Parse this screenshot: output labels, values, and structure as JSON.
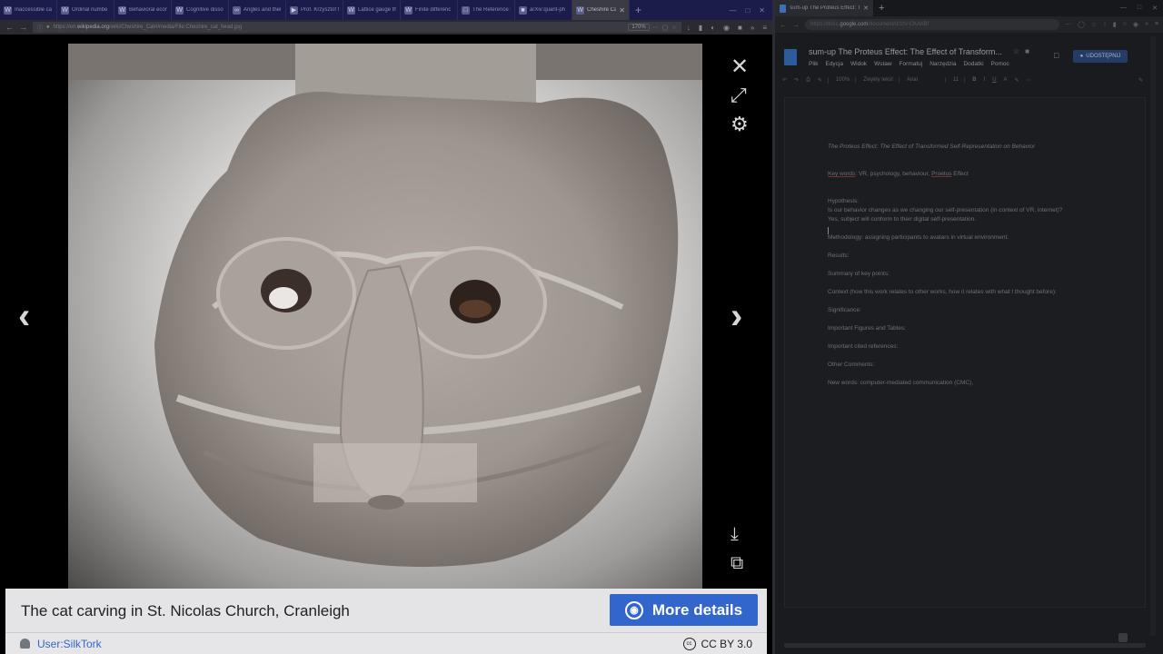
{
  "left_browser": {
    "tabs": [
      {
        "title": "Inaccessible ca",
        "favicon": "W"
      },
      {
        "title": "Ordinal numbe",
        "favicon": "W"
      },
      {
        "title": "Behavioral econ",
        "favicon": "W"
      },
      {
        "title": "Cognitive disso",
        "favicon": "W"
      },
      {
        "title": "Angles and thei",
        "favicon": "∞"
      },
      {
        "title": "Prof. Krzysztof M",
        "favicon": "▶"
      },
      {
        "title": "Lattice gauge th",
        "favicon": "W"
      },
      {
        "title": "Finite differenc",
        "favicon": "W"
      },
      {
        "title": "The Reference F",
        "favicon": "□"
      },
      {
        "title": "arXiv:quant-ph",
        "favicon": "■"
      },
      {
        "title": "Cheshire Ca",
        "favicon": "W",
        "active": true
      }
    ],
    "new_tab": "+",
    "url_prefix": "https://en.",
    "url_domain": "wikipedia.org",
    "url_path": "/wiki/Cheshire_Cat#/media/File:Cheshire_cat_head.jpg",
    "zoom": "170%"
  },
  "media_viewer": {
    "close_icon": "close-icon",
    "fullscreen_icon": "fullscreen-icon",
    "settings_icon": "gear-icon",
    "prev_icon": "chevron-left-icon",
    "next_icon": "chevron-right-icon",
    "download_icon": "download-icon",
    "share_icon": "share-icon",
    "caption": "The cat carving in St. Nicolas Church, Cranleigh",
    "more_details": "More details",
    "author": "User:SilkTork",
    "license": "CC BY 3.0",
    "license_badge": "cc"
  },
  "right_browser": {
    "tab_title": "sum-up The Proteus Effect: The",
    "url_prefix": "https://docs.",
    "url_domain": "google.com",
    "url_path": "/document/d/1tV-CKAhBf",
    "doc": {
      "title": "sum-up The Proteus Effect: The Effect of Transform...",
      "menu": [
        "Plik",
        "Edycja",
        "Widok",
        "Wstaw",
        "Formatuj",
        "Narzędzia",
        "Dodatki",
        "Pomoc"
      ],
      "share": "UDOSTĘPNIJ",
      "toolbar": {
        "zoom": "100%",
        "style": "Zwykły tekst",
        "font": "Arial",
        "size": "11"
      },
      "body": {
        "heading": "The Proteus Effect: The Effect of Transformed Self-Representation on Behavior",
        "key_words_label": "Key words",
        "key_words": ": VR, psychology, behaviour, ",
        "proteus": "Proetus",
        "effect": " Effect",
        "hypothesis": "Hypothesis:",
        "question": "Is our behavior changes as we changing our self-presentation (in context of VR, internet)?",
        "answer": "Yes, subject will conform to their digital self-presentation.",
        "methodology": "Methodology: assigning participants to avatars in virtual environment.",
        "results": "Results:",
        "summary": "Summary of key points:",
        "context": "Context (how this work relates to other works, how it relates with what I thought before):",
        "significance": "Significance:",
        "figures": "Important Figures and Tables:",
        "references": "Important cited references:",
        "other": "Other Comments:",
        "new_words": "New words: computer-mediated communication (CMC),"
      }
    }
  }
}
